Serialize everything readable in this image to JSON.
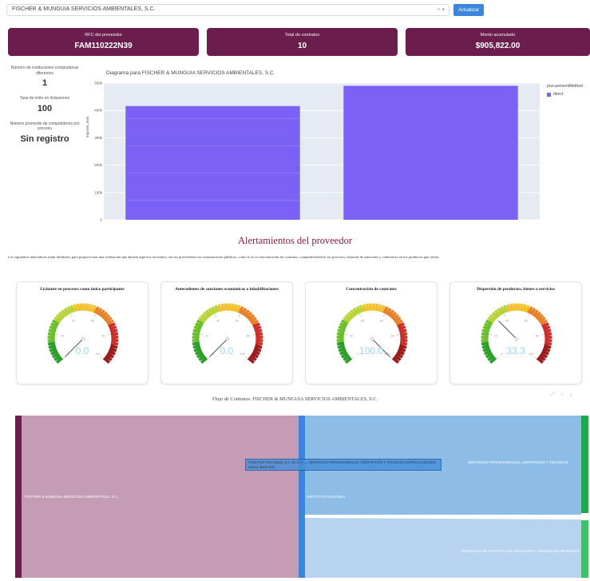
{
  "selector": {
    "value": "FISCHER & MUNGUIA SERVICIOS AMBIENTALES, S.C.",
    "icons": "× ▾",
    "button_label": "Actualizar"
  },
  "kpis": [
    {
      "label": "RFC del proveedor",
      "value": "FAM110222N39"
    },
    {
      "label": "Total de contratos",
      "value": "10"
    },
    {
      "label": "Monto acumulado",
      "value": "$905,822.00"
    }
  ],
  "stats": [
    {
      "label": "Número de instituciones compradoras diferentes",
      "value": "1"
    },
    {
      "label": "Tasa de éxito en licitaciones",
      "value": "100"
    },
    {
      "label": "Número promedio de competidores por proceso",
      "value": "Sin registro"
    }
  ],
  "chart": {
    "title": "Diagrama para FISCHER & MUNGUIA SERVICIOS AMBIENTALES, S.C.",
    "ylabel": "Importe_mxn",
    "legend_title": "procurementMethod",
    "legend_item": "direct",
    "yticks": [
      "500k",
      "400k",
      "300k",
      "200k",
      "100k",
      "0"
    ]
  },
  "chart_data": {
    "type": "bar",
    "categories": [
      "",
      ""
    ],
    "series": [
      {
        "name": "direct",
        "values": [
          416000,
          490000
        ]
      }
    ],
    "ylim": [
      0,
      500000
    ],
    "grid": true,
    "legend_position": "top-right",
    "color": "#7b61f5"
  },
  "alerts": {
    "title": "Alertamientos del proveedor",
    "description": "Los siguientes indicadores están diseñados para proporcionar una evaluación que aborda aspectos asociados con los proveedores en contrataciones públicas, como lo es la concentración de contratos, competitividad en los procesos, historial de sanciones y coherencia en los productos que oferta.",
    "gauges": [
      {
        "title": "Licitante en procesos como único participante",
        "value": "0.0",
        "level": 0
      },
      {
        "title": "Antecedentes de sanciones económicas o inhabilitaciones",
        "value": "0.0",
        "level": 0
      },
      {
        "title": "Concentración de contratos",
        "value": "100.0",
        "level": 100
      },
      {
        "title": "Dispersión de productos, bienes o servicios",
        "value": "33.3",
        "level": 33.3
      }
    ],
    "gauge_ticks": [
      "0",
      "20",
      "40",
      "60",
      "80",
      "100"
    ]
  },
  "sankey": {
    "title": "Flujo de Contratos: FISCHER & MUNGUIA SERVICIOS AMBIENTALES, S.C.",
    "tools": "⤢ ⌂ ⤓",
    "left_label": "FISCHER & MUNGUIA SERVICIOS AMBIENTALES, S.C.",
    "middle_label": "INSTITUTO NACIONAL",
    "right_top_label": "SERVICIOS PROFESIONALES, CIENTIFICOS Y TECNICOS",
    "right_bottom_label": "SERVICIOS DE APOYO A LOS NEGOCIOS Y MANEJO DE RESIDUOS",
    "tooltip": "FONATUR Tren Maya, S.A. de C.V. → SERVICIOS PROFESIONALES, CIENTIFICOS Y TECNICOS ESPECIALIZADOS Monto: $480,000"
  }
}
